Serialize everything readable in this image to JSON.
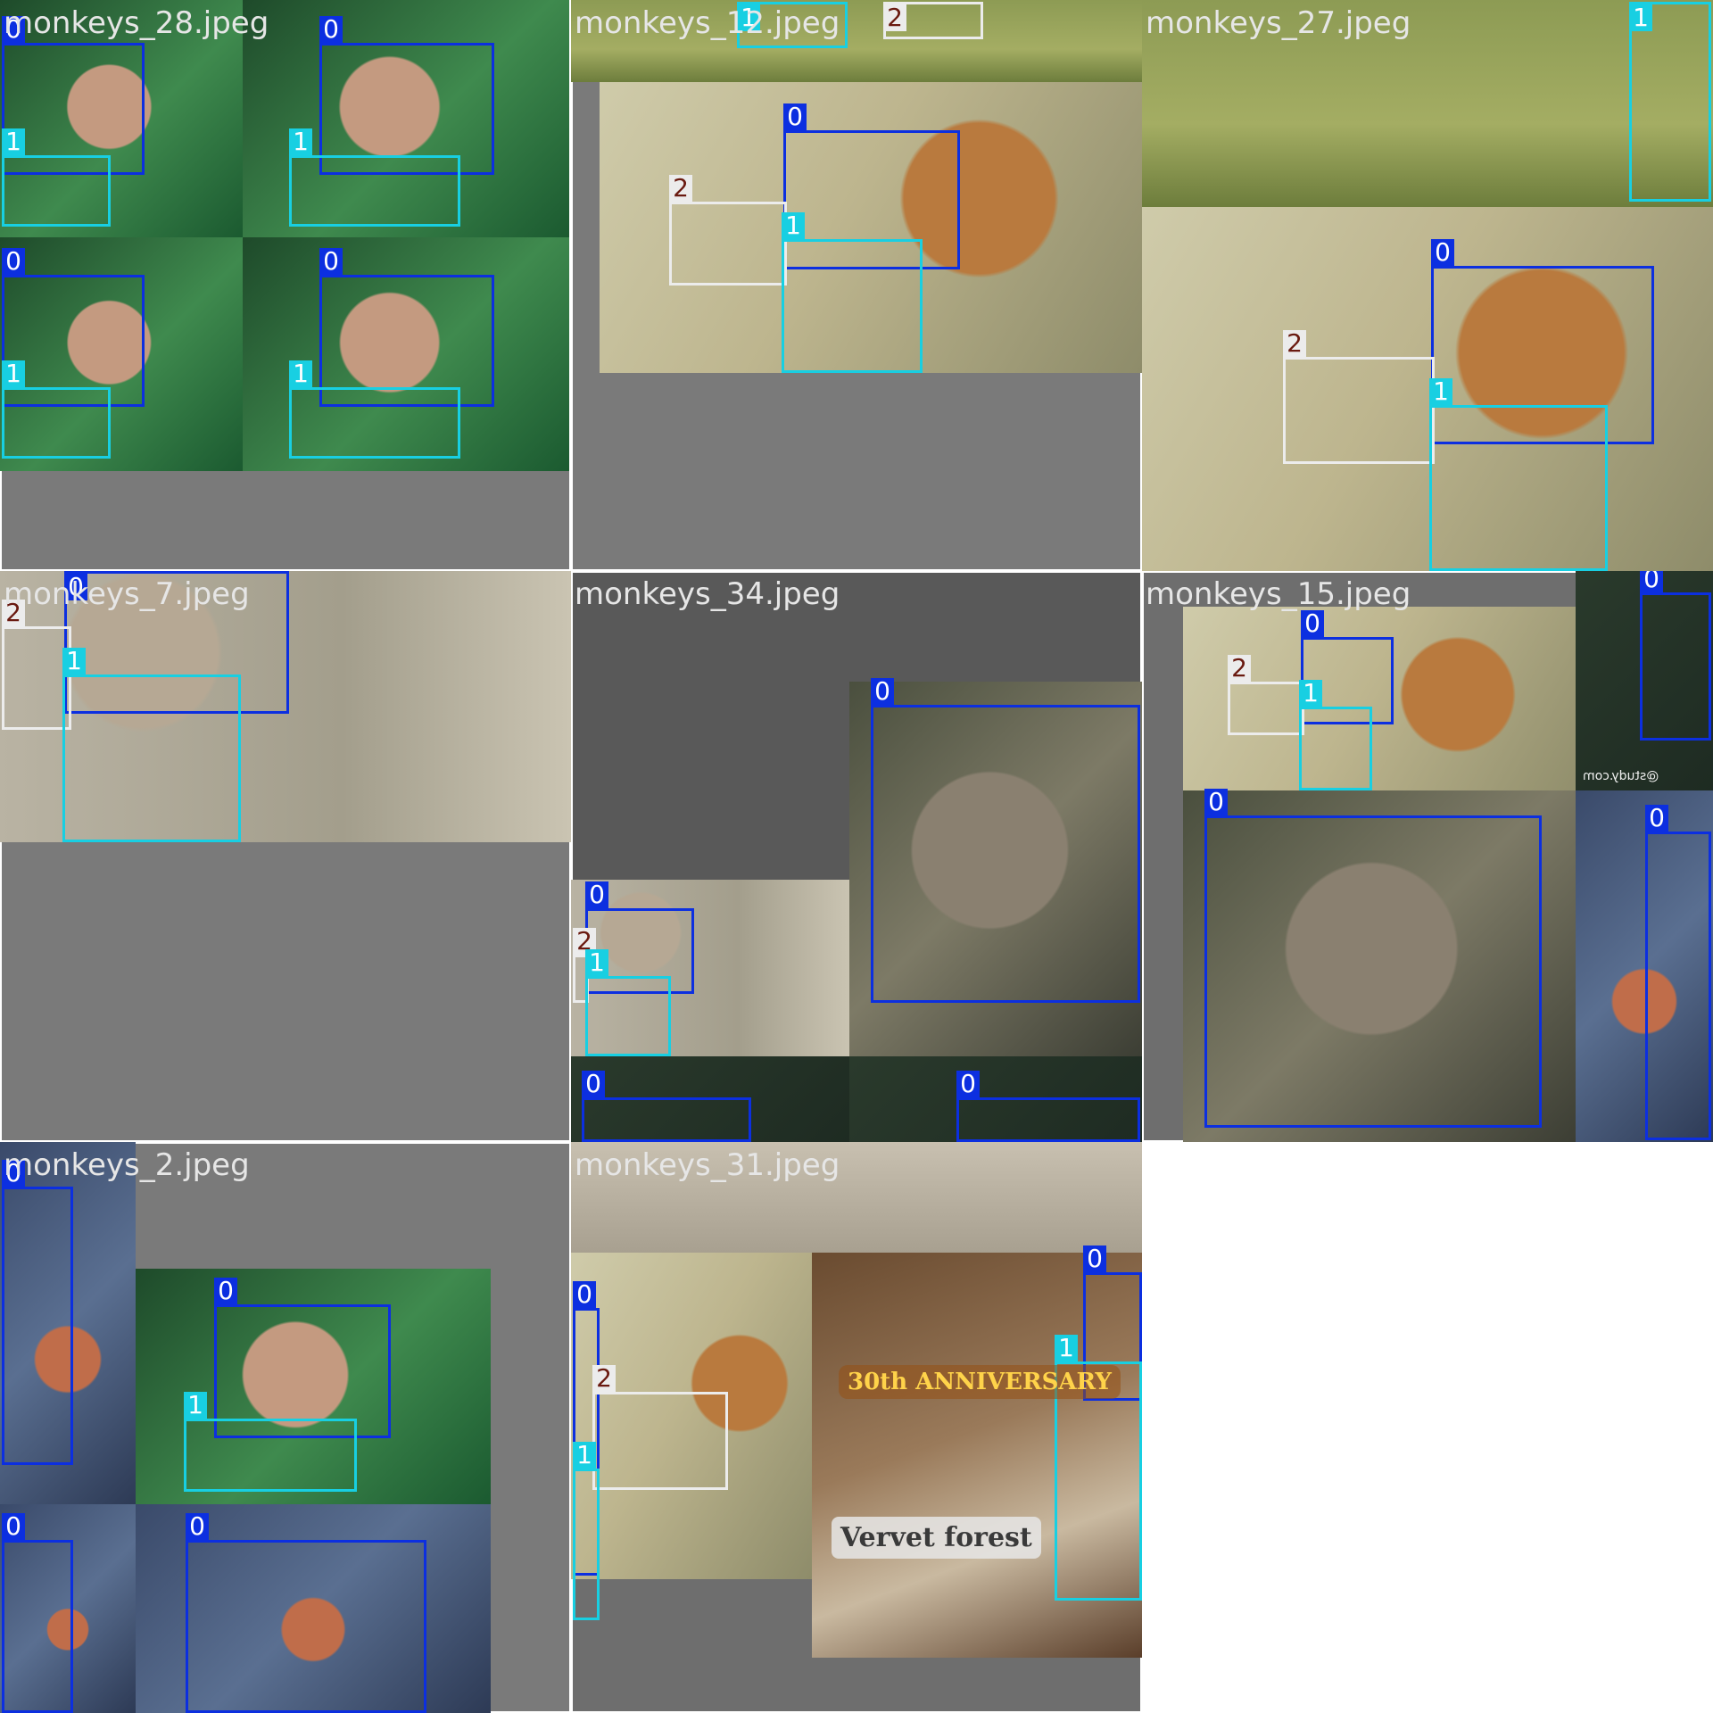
{
  "colors": {
    "class_0": "#0c2fe0",
    "class_1": "#18cfe2",
    "class_2": "#ececec",
    "class_2_text": "#6a1a10",
    "padding_grey": "#7a7a7a"
  },
  "tiles": [
    {
      "title": "monkeys_28.jpeg",
      "photos": [
        {
          "scene": "g-forest"
        },
        {
          "scene": "g-forest"
        },
        {
          "scene": "g-forest"
        },
        {
          "scene": "g-forest"
        }
      ],
      "boxes": [
        {
          "label": "0",
          "cls": 0
        },
        {
          "label": "1",
          "cls": 1
        },
        {
          "label": "0",
          "cls": 0
        },
        {
          "label": "1",
          "cls": 1
        },
        {
          "label": "0",
          "cls": 0
        },
        {
          "label": "1",
          "cls": 1
        },
        {
          "label": "0",
          "cls": 0
        },
        {
          "label": "1",
          "cls": 1
        }
      ]
    },
    {
      "title": "monkeys_12.jpeg",
      "photos": [
        {
          "scene": "g-grass"
        },
        {
          "scene": "g-shirt"
        }
      ],
      "boxes": [
        {
          "label": "1",
          "cls": 1
        },
        {
          "label": "2",
          "cls": 2
        },
        {
          "label": "0",
          "cls": 0
        },
        {
          "label": "2",
          "cls": 2
        },
        {
          "label": "1",
          "cls": 1
        }
      ]
    },
    {
      "title": "monkeys_27.jpeg",
      "photos": [
        {
          "scene": "g-grass"
        },
        {
          "scene": "g-shirt"
        }
      ],
      "boxes": [
        {
          "label": "1",
          "cls": 1
        },
        {
          "label": "0",
          "cls": 0
        },
        {
          "label": "2",
          "cls": 2
        },
        {
          "label": "1",
          "cls": 1
        }
      ]
    },
    {
      "title": "monkeys_7.jpeg",
      "photos": [
        {
          "scene": "g-pale"
        }
      ],
      "boxes": [
        {
          "label": "0",
          "cls": 0
        },
        {
          "label": "2",
          "cls": 2
        },
        {
          "label": "1",
          "cls": 1
        }
      ]
    },
    {
      "title": "monkeys_34.jpeg",
      "photos": [
        {
          "scene": "g-grey"
        },
        {
          "scene": "g-pale"
        },
        {
          "scene": "g-dark"
        },
        {
          "scene": "g-dark"
        }
      ],
      "boxes": [
        {
          "label": "0",
          "cls": 0
        },
        {
          "label": "0",
          "cls": 0
        },
        {
          "label": "2",
          "cls": 2
        },
        {
          "label": "1",
          "cls": 1
        },
        {
          "label": "0",
          "cls": 0
        },
        {
          "label": "0",
          "cls": 0
        }
      ]
    },
    {
      "title": "monkeys_15.jpeg",
      "photos": [
        {
          "scene": "g-shirt"
        },
        {
          "scene": "g-dark"
        },
        {
          "scene": "g-grey"
        },
        {
          "scene": "g-blue"
        }
      ],
      "watermark": "@study.com",
      "boxes": [
        {
          "label": "0",
          "cls": 0
        },
        {
          "label": "2",
          "cls": 2
        },
        {
          "label": "1",
          "cls": 1
        },
        {
          "label": "0",
          "cls": 0
        },
        {
          "label": "0",
          "cls": 0
        },
        {
          "label": "0",
          "cls": 0
        }
      ]
    },
    {
      "title": "monkeys_2.jpeg",
      "photos": [
        {
          "scene": "g-blue"
        },
        {
          "scene": "g-forest"
        },
        {
          "scene": "g-blue"
        },
        {
          "scene": "g-blue"
        }
      ],
      "boxes": [
        {
          "label": "0",
          "cls": 0
        },
        {
          "label": "0",
          "cls": 0
        },
        {
          "label": "1",
          "cls": 1
        },
        {
          "label": "0",
          "cls": 0
        },
        {
          "label": "0",
          "cls": 0
        }
      ]
    },
    {
      "title": "monkeys_31.jpeg",
      "photos": [
        {
          "scene": "g-fur"
        },
        {
          "scene": "g-shirt"
        },
        {
          "scene": "g-room"
        }
      ],
      "stamp_text": "30th ANNIVERSARY",
      "stamp2_text": "Vervet forest",
      "boxes": [
        {
          "label": "0",
          "cls": 0
        },
        {
          "label": "2",
          "cls": 2
        },
        {
          "label": "1",
          "cls": 1
        },
        {
          "label": "0",
          "cls": 0
        },
        {
          "label": "1",
          "cls": 1
        }
      ]
    }
  ]
}
